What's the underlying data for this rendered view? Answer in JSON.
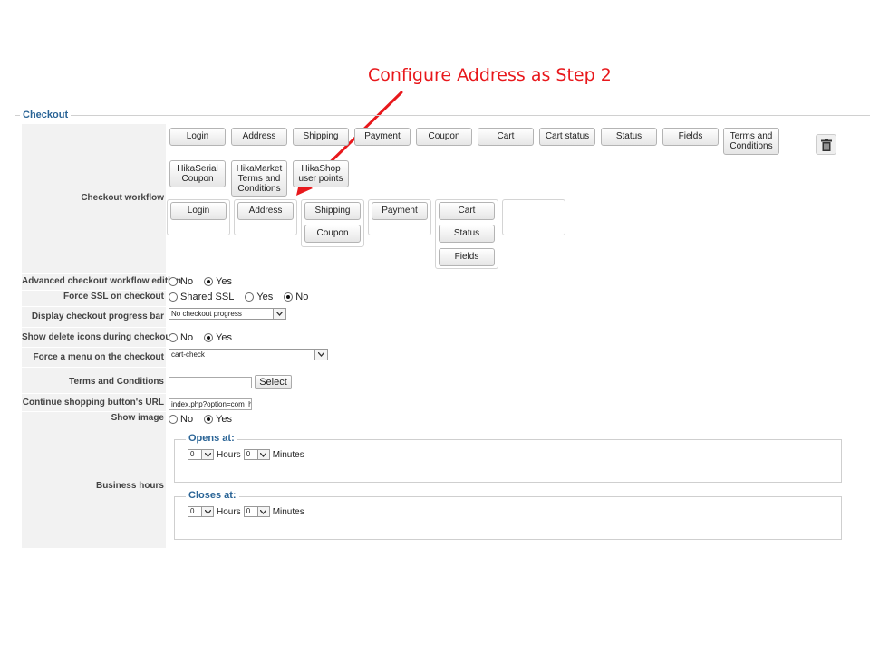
{
  "annotation": {
    "text": "Configure Address as Step 2"
  },
  "section": {
    "title": "Checkout"
  },
  "labels": {
    "checkout_workflow": "Checkout workflow",
    "advanced_workflow": "Advanced checkout workflow edition",
    "force_ssl": "Force SSL on checkout",
    "progress_bar": "Display checkout progress bar",
    "delete_icons": "Show delete icons during checkout",
    "force_menu": "Force a menu on the checkout",
    "terms": "Terms and Conditions",
    "continue_url": "Continue shopping button's URL",
    "show_image": "Show image",
    "business_hours": "Business hours"
  },
  "workflow": {
    "available": [
      "Login",
      "Address",
      "Shipping",
      "Payment",
      "Coupon",
      "Cart",
      "Cart status",
      "Status",
      "Fields",
      "Terms and Conditions",
      "HikaSerial Coupon",
      "HikaMarket Terms and Conditions",
      "HikaShop user points"
    ],
    "steps": [
      [
        "Login"
      ],
      [
        "Address"
      ],
      [
        "Shipping",
        "Coupon"
      ],
      [
        "Payment"
      ],
      [
        "Cart",
        "Status",
        "Fields"
      ],
      []
    ]
  },
  "options": {
    "no": "No",
    "yes": "Yes",
    "shared_ssl": "Shared SSL",
    "advanced_selected": "Yes",
    "ssl_selected": "No",
    "delete_icons_selected": "Yes",
    "show_image_selected": "Yes"
  },
  "progress_bar_value": "No checkout progress",
  "force_menu_value": "cart-check",
  "terms_value": "",
  "select_label": "Select",
  "continue_url_value": "index.php?option=com_h",
  "business_hours": {
    "opens_label": "Opens at:",
    "closes_label": "Closes at:",
    "hours_label": "Hours",
    "minutes_label": "Minutes",
    "open_hour": "0",
    "open_minute": "0",
    "close_hour": "0",
    "close_minute": "0"
  },
  "icons": {
    "delete": "trash-icon",
    "dropdown": "chevron-down-icon"
  },
  "colors": {
    "annotation": "#e8181c",
    "legend": "#2a6496"
  }
}
